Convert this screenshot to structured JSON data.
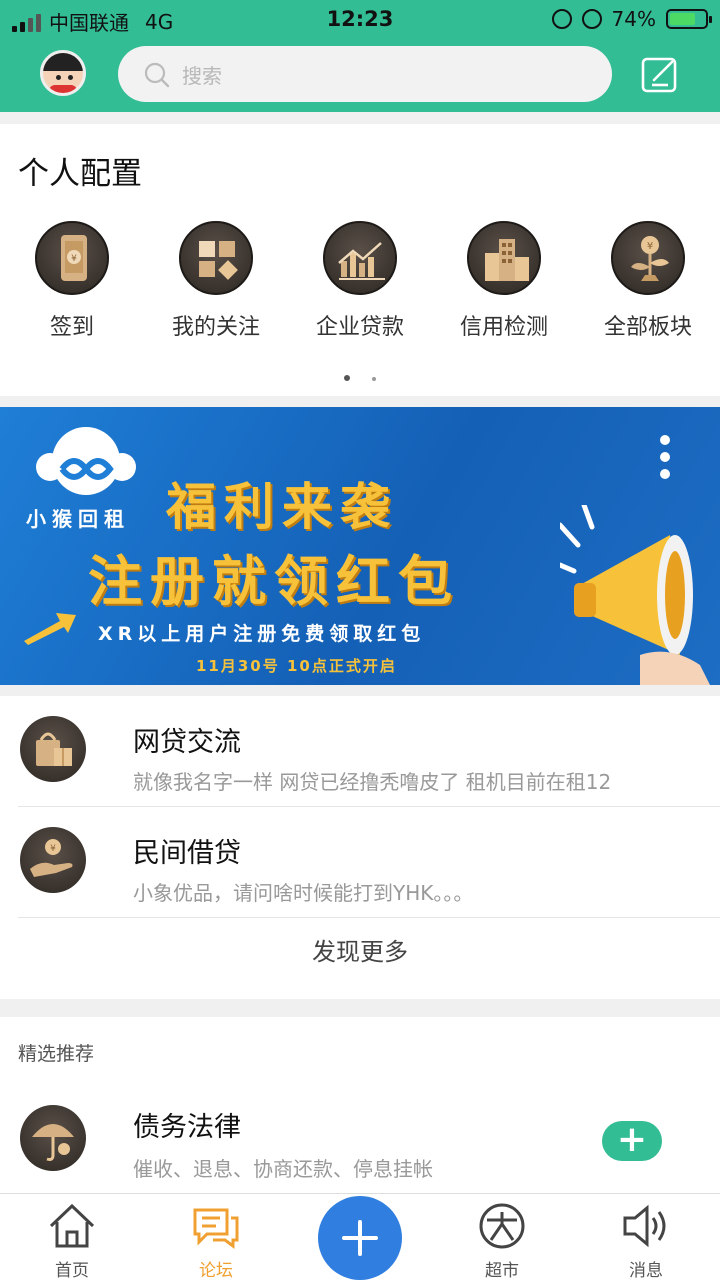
{
  "status": {
    "carrier": "中国联通",
    "network": "4G",
    "time": "12:23",
    "battery": "74%",
    "battery_level": 0.74
  },
  "header": {
    "search_placeholder": "搜索",
    "icons": [
      "avatar",
      "search-icon",
      "edit-icon"
    ]
  },
  "config": {
    "title": "个人配置",
    "items": [
      {
        "label": "签到",
        "icon": "phone-coin-icon"
      },
      {
        "label": "我的关注",
        "icon": "grid-icon"
      },
      {
        "label": "企业贷款",
        "icon": "bar-chart-icon"
      },
      {
        "label": "信用检测",
        "icon": "building-icon"
      },
      {
        "label": "全部板块",
        "icon": "money-plant-icon"
      }
    ],
    "page_dots": 2,
    "active_dot": 0
  },
  "banner": {
    "brand": "小猴回租",
    "line1": "福利来袭",
    "line2": "注册就领红包",
    "line3": "XR以上用户注册免费领取红包",
    "line4": "11月30号 10点正式开启"
  },
  "forum": {
    "items": [
      {
        "title": "网贷交流",
        "subtitle": "就像我名字一样 网贷已经撸秃噜皮了 租机目前在租12",
        "icon": "shopping-bag-icon"
      },
      {
        "title": "民间借贷",
        "subtitle": "小象优品，请问啥时候能打到YHK。。。",
        "icon": "hand-coin-icon"
      }
    ],
    "more_label": "发现更多"
  },
  "featured": {
    "title": "精选推荐",
    "item": {
      "title": "债务法律",
      "subtitle": "催收、退息、协商还款、停息挂帐",
      "icon": "umbrella-icon",
      "action": "+"
    }
  },
  "tabbar": {
    "tabs": [
      {
        "label": "首页",
        "icon": "home-icon"
      },
      {
        "label": "论坛",
        "icon": "chat-icon",
        "active": true
      },
      {
        "label": "超市",
        "icon": "market-icon"
      },
      {
        "label": "消息",
        "icon": "speaker-icon"
      }
    ],
    "fab_icon": "plus-icon"
  },
  "colors": {
    "brand": "#33bd95",
    "active_tab": "#f0a030",
    "fab": "#2f7ee0",
    "banner_blue": "#1d6dc4",
    "banner_gold": "#f7c23a"
  }
}
